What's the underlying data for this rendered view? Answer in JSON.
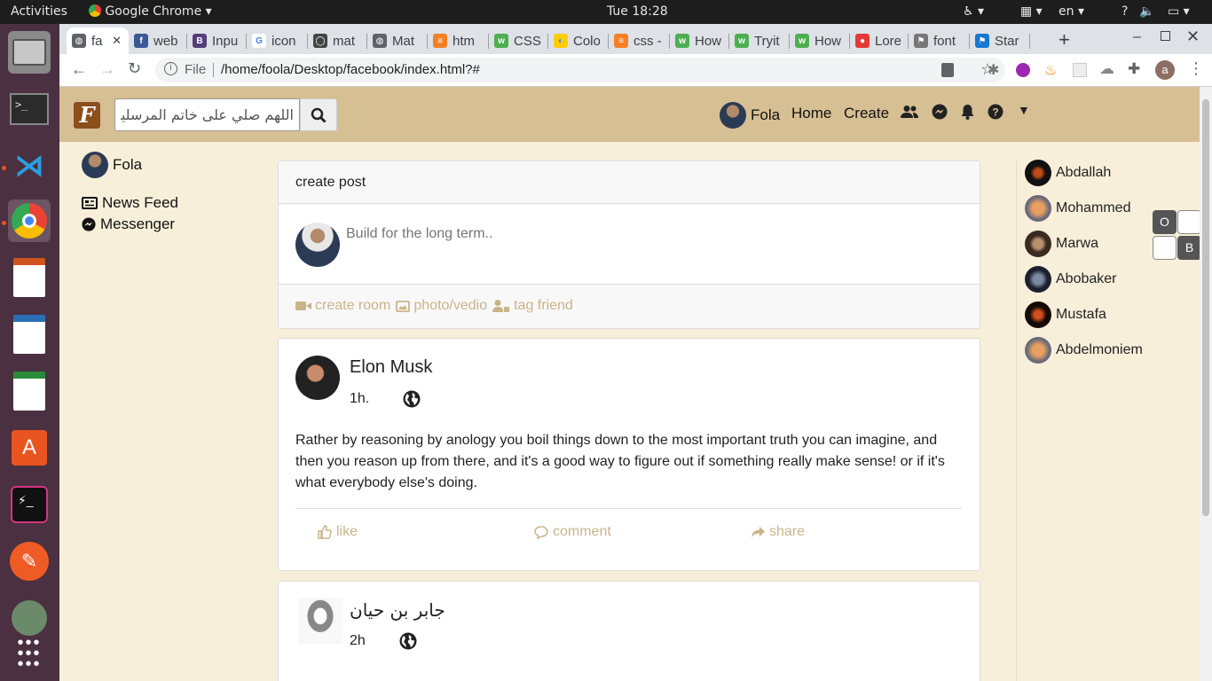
{
  "os": {
    "activities": "Activities",
    "app_name": "Google Chrome",
    "clock": "Tue 18:28",
    "lang": "en",
    "help": "?"
  },
  "tabs": [
    {
      "label": "fa",
      "color": "#5f6368",
      "glyph": "◍"
    },
    {
      "label": "web",
      "color": "#3b5998",
      "glyph": "f"
    },
    {
      "label": "Inpu",
      "color": "#563d7c",
      "glyph": "B"
    },
    {
      "label": "icon",
      "color": "#ffffff",
      "glyph": "G"
    },
    {
      "label": "mat",
      "color": "#444444",
      "glyph": "◯"
    },
    {
      "label": "Mat",
      "color": "#5f6368",
      "glyph": "◍"
    },
    {
      "label": "htm",
      "color": "#f48024",
      "glyph": "≡"
    },
    {
      "label": "CSS",
      "color": "#4caf50",
      "glyph": "w"
    },
    {
      "label": "Colo",
      "color": "#ffcc00",
      "glyph": "◐"
    },
    {
      "label": "css -",
      "color": "#f48024",
      "glyph": "≡"
    },
    {
      "label": "How",
      "color": "#4caf50",
      "glyph": "w"
    },
    {
      "label": "Tryit",
      "color": "#4caf50",
      "glyph": "w"
    },
    {
      "label": "How",
      "color": "#4caf50",
      "glyph": "w"
    },
    {
      "label": "Lore",
      "color": "#e53935",
      "glyph": "●"
    },
    {
      "label": "font",
      "color": "#777777",
      "glyph": "⚑"
    },
    {
      "label": "Star",
      "color": "#1976d2",
      "glyph": "⚑"
    }
  ],
  "browser": {
    "file_label": "File",
    "url": "/home/foola/Desktop/facebook/index.html?#",
    "profile_initial": "a"
  },
  "navbar": {
    "logo": "F",
    "search_value": "اللهم صلي على خاتم المرسلين",
    "user": "Fola",
    "home": "Home",
    "create": "Create"
  },
  "sidebar": {
    "user": "Fola",
    "items": [
      "News Feed",
      "Messenger"
    ]
  },
  "create_post": {
    "header": "create post",
    "placeholder": "Build for the long term..",
    "actions": [
      "create room",
      "photo/vedio",
      "tag friend"
    ]
  },
  "posts": [
    {
      "author": "Elon Musk",
      "time": "1h.",
      "text": "Rather by reasoning by anology you boil things down to the most important truth you can imagine, and then you reason up from there, and it's a good way to figure out if something really make sense! or if it's what everybody else's doing.",
      "actions": [
        "like",
        "comment",
        "share"
      ]
    },
    {
      "author": "جابر بن حيان",
      "time": "2h"
    }
  ],
  "contacts": [
    "Abdallah",
    "Mohammed",
    "Marwa",
    "Abobaker",
    "Mustafa",
    "Abdelmoniem"
  ],
  "floating_buttons": [
    "O",
    "B"
  ],
  "colors": {
    "navbar": "#d7bf94",
    "page_bg": "#f7efd9",
    "muted": "#c9b48a",
    "dock": "#4a3040"
  }
}
